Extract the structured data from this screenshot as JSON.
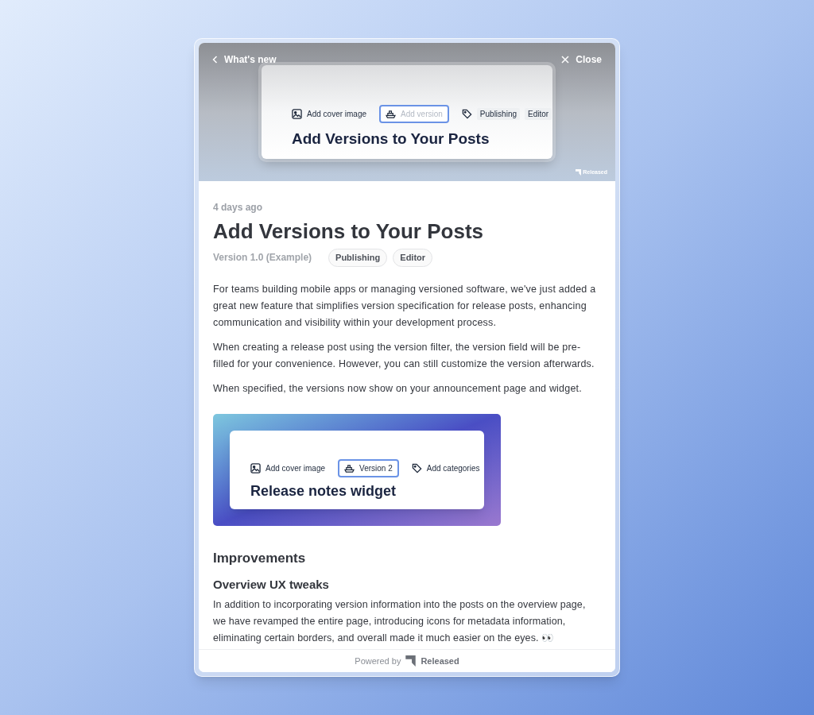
{
  "header": {
    "back_label": "What's new",
    "close_label": "Close",
    "cover": {
      "toolbar": [
        {
          "kind": "image",
          "label": "Add cover image"
        },
        {
          "kind": "version",
          "placeholder": "Add version"
        },
        {
          "kind": "tags",
          "tags": [
            "Publishing",
            "Editor"
          ]
        }
      ],
      "title": "Add Versions to Your Posts",
      "brand": "Released"
    }
  },
  "post": {
    "date": "4 days ago",
    "title": "Add Versions to Your Posts",
    "version": "Version 1.0 (Example)",
    "tags": [
      "Publishing",
      "Editor"
    ],
    "paragraphs": [
      "For teams building mobile apps or managing versioned software, we've just added a great new feature that simplifies version specification for release posts, enhancing communication and visibility within your development process.",
      "When creating a release post using the version filter, the version field will be pre-filled for your convenience. However, you can still customize the version afterwards.",
      "When specified, the versions now show on your announcement page and widget."
    ],
    "media": {
      "toolbar": [
        {
          "kind": "image",
          "label": "Add cover image"
        },
        {
          "kind": "version",
          "value": "Version 2"
        },
        {
          "kind": "categories",
          "label": "Add categories"
        }
      ],
      "title": "Release notes widget"
    },
    "heading": "Improvements",
    "subheading": "Overview UX tweaks",
    "closing_paragraph": "In addition to incorporating version information into the posts on the overview page, we have revamped the entire page, introducing icons for metadata information, eliminating certain borders, and overall made it much easier on the eyes. 👀"
  },
  "footer": {
    "powered_by": "Powered by",
    "brand": "Released"
  }
}
